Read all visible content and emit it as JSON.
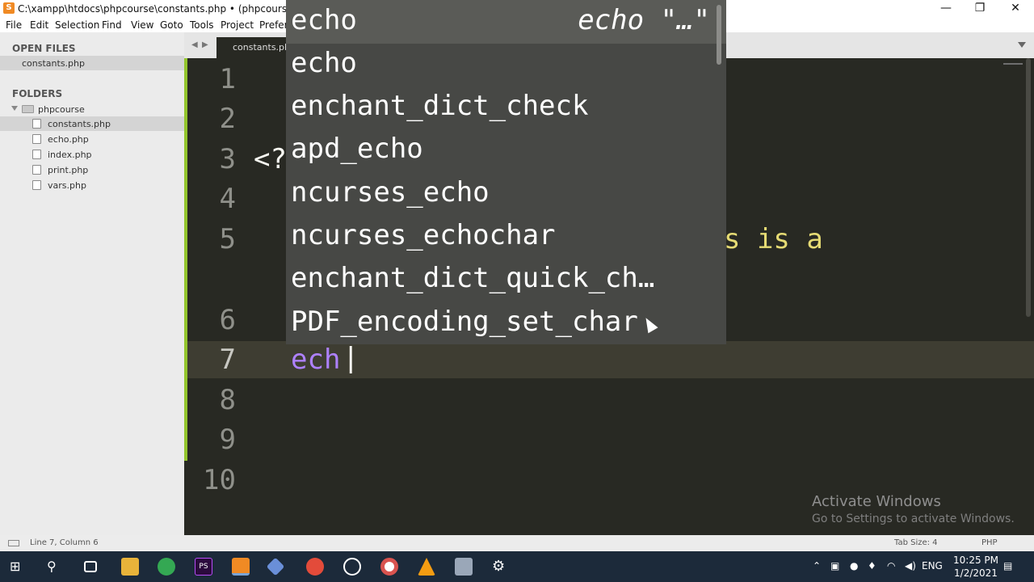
{
  "window": {
    "title": "C:\\xampp\\htdocs\\phpcourse\\constants.php • (phpcourse) - Sublim",
    "minimize": "—",
    "maximize": "❐",
    "close": "✕"
  },
  "menu": [
    "File",
    "Edit",
    "Selection",
    "Find",
    "View",
    "Goto",
    "Tools",
    "Project",
    "Prefere"
  ],
  "sidebar": {
    "open_files_title": "OPEN FILES",
    "open_files": [
      "constants.php"
    ],
    "folders_title": "FOLDERS",
    "folder_name": "phpcourse",
    "files": [
      "constants.php",
      "echo.php",
      "index.php",
      "print.php",
      "vars.php"
    ]
  },
  "tab": {
    "label": "constants.php"
  },
  "editor": {
    "line_numbers": [
      "1",
      "2",
      "3",
      "4",
      "5",
      "6",
      "7",
      "8",
      "9",
      "10"
    ],
    "line3_fragment": "<?",
    "line5_fragment": "s is a",
    "current_input": "ech"
  },
  "autocomplete": {
    "header_item": "echo",
    "header_hint": "echo \"…\"",
    "items": [
      "echo",
      "enchant_dict_check",
      "apd_echo",
      "ncurses_echo",
      "ncurses_echochar",
      "enchant_dict_quick_ch…",
      "PDF_encoding_set_char"
    ]
  },
  "watermark": {
    "line1": "Activate Windows",
    "line2": "Go to Settings to activate Windows."
  },
  "status": {
    "position": "Line 7, Column 6",
    "tab_size": "Tab Size: 4",
    "syntax": "PHP"
  },
  "taskbar": {
    "language": "ENG",
    "time": "10:25 PM",
    "date": "1/2/2021"
  },
  "colors": {
    "editor_bg": "#282923",
    "popup_bg": "#474845",
    "keyword_purple": "#ae81ff",
    "string_yellow": "#e6db74",
    "gutter_green": "#a6e22e"
  }
}
